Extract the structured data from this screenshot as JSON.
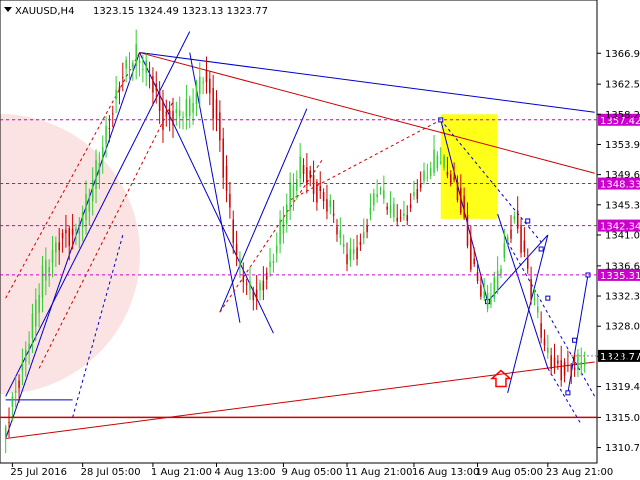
{
  "header": {
    "symbol": "XAUUSD,H4",
    "quote": "1323.15 1324.49 1323.13 1323.77",
    "menu_icon": "triangle-down-icon"
  },
  "chart_data": {
    "type": "candlestick",
    "symbol": "XAUUSD",
    "timeframe": "H4",
    "ohlc": {
      "open": 1323.15,
      "high": 1324.49,
      "low": 1323.13,
      "close": 1323.77
    },
    "ylim": [
      1309.5,
      1370.5
    ],
    "y_ticks": [
      1366.9,
      1362.5,
      1358.2,
      1353.9,
      1349.6,
      1345.3,
      1341.0,
      1336.6,
      1332.3,
      1328.0,
      1323.7,
      1319.4,
      1315.0,
      1310.7
    ],
    "x_ticks": [
      "25 Jul 2016",
      "28 Jul 05:00",
      "1 Aug 21:00",
      "4 Aug 13:00",
      "9 Aug 05:00",
      "11 Aug 21:00",
      "16 Aug 13:00",
      "19 Aug 05:00",
      "23 Aug 21:00"
    ],
    "x_tick_pos": [
      2,
      23,
      44,
      63,
      83,
      102,
      122,
      141,
      162
    ],
    "n_bars": 176,
    "current_price": 1323.77,
    "levels": [
      {
        "label": "1357.42",
        "value": 1357.42,
        "color": "#c000c0"
      },
      {
        "label": "1348.33",
        "value": 1348.33,
        "color": "#c000c0"
      },
      {
        "label": "1342.34",
        "value": 1342.34,
        "color": "#c000c0"
      },
      {
        "label": "1335.31",
        "value": 1335.31,
        "color": "#c000c0"
      }
    ],
    "support_level": 1315.0,
    "price_path": [
      [
        0,
        1312
      ],
      [
        6,
        1322
      ],
      [
        12,
        1336
      ],
      [
        17,
        1340
      ],
      [
        22,
        1341
      ],
      [
        27,
        1349
      ],
      [
        32,
        1357
      ],
      [
        36,
        1364
      ],
      [
        40,
        1367
      ],
      [
        44,
        1364
      ],
      [
        48,
        1357
      ],
      [
        52,
        1358
      ],
      [
        56,
        1360
      ],
      [
        60,
        1364
      ],
      [
        64,
        1357
      ],
      [
        67,
        1347
      ],
      [
        70,
        1338
      ],
      [
        73,
        1334
      ],
      [
        76,
        1332
      ],
      [
        80,
        1336
      ],
      [
        85,
        1346
      ],
      [
        89,
        1351
      ],
      [
        93,
        1347
      ],
      [
        98,
        1345
      ],
      [
        103,
        1338
      ],
      [
        107,
        1339
      ],
      [
        112,
        1348
      ],
      [
        116,
        1345
      ],
      [
        120,
        1343
      ],
      [
        125,
        1348
      ],
      [
        130,
        1353
      ],
      [
        134,
        1349
      ],
      [
        137,
        1345
      ],
      [
        140,
        1337
      ],
      [
        144,
        1332
      ],
      [
        147,
        1334
      ],
      [
        150,
        1339
      ],
      [
        153,
        1343
      ],
      [
        156,
        1338
      ],
      [
        158,
        1333
      ],
      [
        160,
        1330
      ],
      [
        162,
        1325
      ],
      [
        165,
        1322
      ],
      [
        168,
        1321
      ],
      [
        171,
        1322
      ],
      [
        173,
        1323.77
      ]
    ],
    "colors": {
      "bull": "#33cc33",
      "bear": "#cc0000",
      "trendline_blue": "#0000cc",
      "trendline_red": "#cc0000",
      "level_line": "#cc00cc",
      "level_label_bg": "#cc00cc",
      "current_price_bg": "#000000",
      "highlight_box": "#ffff00",
      "arrow": "#ff0000"
    }
  }
}
